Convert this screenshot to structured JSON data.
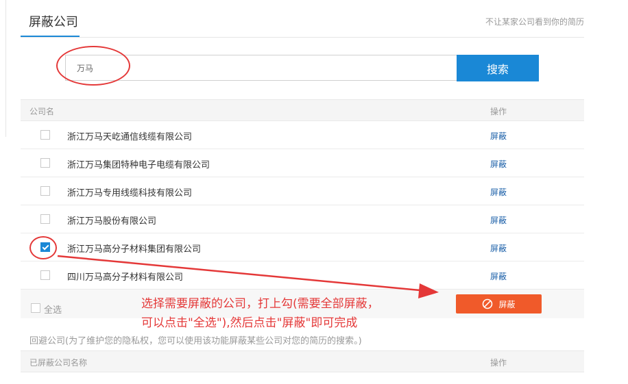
{
  "header": {
    "tab_title": "屏蔽公司",
    "hint": "不让某家公司看到你的简历"
  },
  "search": {
    "value": "万马",
    "button_label": "搜索"
  },
  "table": {
    "col_name": "公司名",
    "col_op": "操作",
    "action_label": "屏蔽",
    "rows": [
      {
        "name": "浙江万马天屹通信线缆有限公司",
        "checked": false
      },
      {
        "name": "浙江万马集团特种电子电缆有限公司",
        "checked": false
      },
      {
        "name": "浙江万马专用线缆科技有限公司",
        "checked": false
      },
      {
        "name": "浙江万马股份有限公司",
        "checked": false
      },
      {
        "name": "浙江万马高分子材料集团有限公司",
        "checked": true
      },
      {
        "name": "四川万马高分子材料有限公司",
        "checked": false
      }
    ]
  },
  "footer": {
    "select_all": "全选",
    "block_button": "屏蔽",
    "block_icon": "ban-icon"
  },
  "annotation": {
    "line1": "选择需要屏蔽的公司，打上勾(需要全部屏蔽，",
    "line2": "可以点击\"全选\"),然后点击\"屏蔽\"即可完成"
  },
  "avoid_section": {
    "text": "回避公司(为了维护您的隐私权，您可以使用该功能屏蔽某些公司对您的简历的搜索。)",
    "col_name": "已屏蔽公司名称",
    "col_op": "操作"
  },
  "colors": {
    "accent": "#1a88d6",
    "danger": "#f05a2a",
    "annotation": "#e43838"
  }
}
